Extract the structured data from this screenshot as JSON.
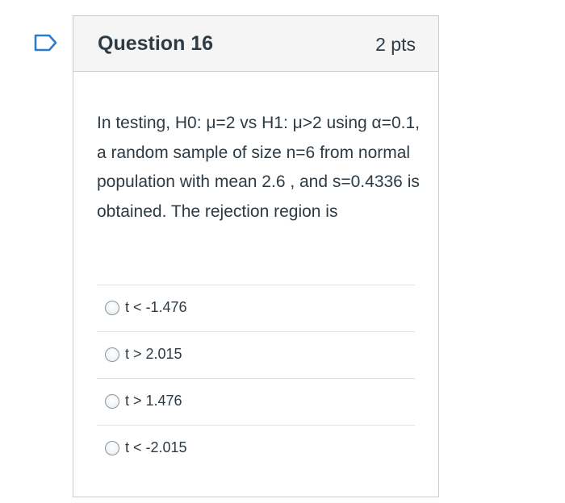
{
  "question": {
    "title": "Question 16",
    "points": "2 pts",
    "text": "In testing, H0: μ=2  vs  H1: μ>2 using α=0.1, a random sample of size n=6 from normal population with mean 2.6 , and s=0.4336 is obtained. The rejection region is"
  },
  "answers": [
    {
      "label": "t < -1.476"
    },
    {
      "label": "t > 2.015"
    },
    {
      "label": "t > 1.476"
    },
    {
      "label": "t < -2.015"
    }
  ],
  "colors": {
    "flag": "#2d7bd0",
    "text": "#2d3b45",
    "border": "#c7cdd1",
    "header_bg": "#f5f5f5"
  },
  "icons": {
    "flag": "bookmark-flag-icon",
    "radio": "radio-unselected-icon"
  }
}
